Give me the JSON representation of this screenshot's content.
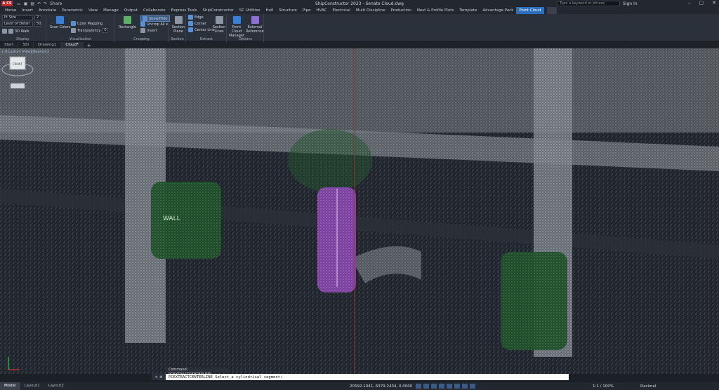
{
  "titlebar": {
    "logo": "A CS",
    "share": "Share",
    "title": "ShipConstructor 2023 - Senato   Cloud.dwg",
    "search_placeholder": "Type a keyword or phrase",
    "signin": "Sign In"
  },
  "ribbon_tabs": [
    "Home",
    "Insert",
    "Annotate",
    "Parametric",
    "View",
    "Manage",
    "Output",
    "Collaborate",
    "Express Tools",
    "ShipConstructor",
    "SC Utilities",
    "Hull",
    "Structure",
    "Pipe",
    "HVAC",
    "Electrical",
    "Multi Discipline",
    "Production",
    "Nest & Profile Plots",
    "Template",
    "Advantage Pack",
    "Point Cloud"
  ],
  "active_tab": "Point Cloud",
  "ribbon": {
    "display": {
      "point_size_label": "Pt Size",
      "point_size_value": "2",
      "lod_label": "Level of Detail",
      "lod_value": "50",
      "walk_label": "3D Walk",
      "title": "Display"
    },
    "visualization": {
      "scan_colors": "Scan Colors",
      "color_mapping": "Color Mapping",
      "transparency": "Transparency",
      "transparency_value": "0",
      "title": "Visualization"
    },
    "cropping": {
      "rectangle": "Rectangle",
      "show_hide": "Show/Hide",
      "uncrop_all": "Uncrop All",
      "invert": "Invert",
      "title": "Cropping"
    },
    "section": {
      "section_plane": "Section Plane",
      "title": "Section"
    },
    "extract": {
      "edge": "Edge",
      "corner": "Corner",
      "center_line": "Center Line",
      "section_lines": "Section Lines",
      "title": "Extract"
    },
    "options": {
      "manager": "Point Cloud Manager",
      "external_reference": "External Reference",
      "title": "Options"
    }
  },
  "doc_tabs": [
    "Start",
    "SSI",
    "Drawing1",
    "Cloud*"
  ],
  "active_doc": "Cloud*",
  "viewport": {
    "label": "[-][Custom View][Realistic]",
    "viewcube_face": "FRONT",
    "scene_text": "WALL"
  },
  "command": {
    "history": "Command: PCEXTRACTCENTERLINE",
    "prompt": "PCEXTRACTCENTERLINE Select a cylindrical segment:"
  },
  "statusbar": {
    "layout_tabs": [
      "Model",
      "Layout1",
      "Layout2"
    ],
    "active_layout": "Model",
    "coords": "20592.1041, 6379.2434, 0.0000",
    "scale": "1:1 / 100%",
    "units": "Decimal"
  },
  "colors": {
    "accent": "#2c6fbf",
    "highlight_cylinder": "#9b5fc0"
  }
}
